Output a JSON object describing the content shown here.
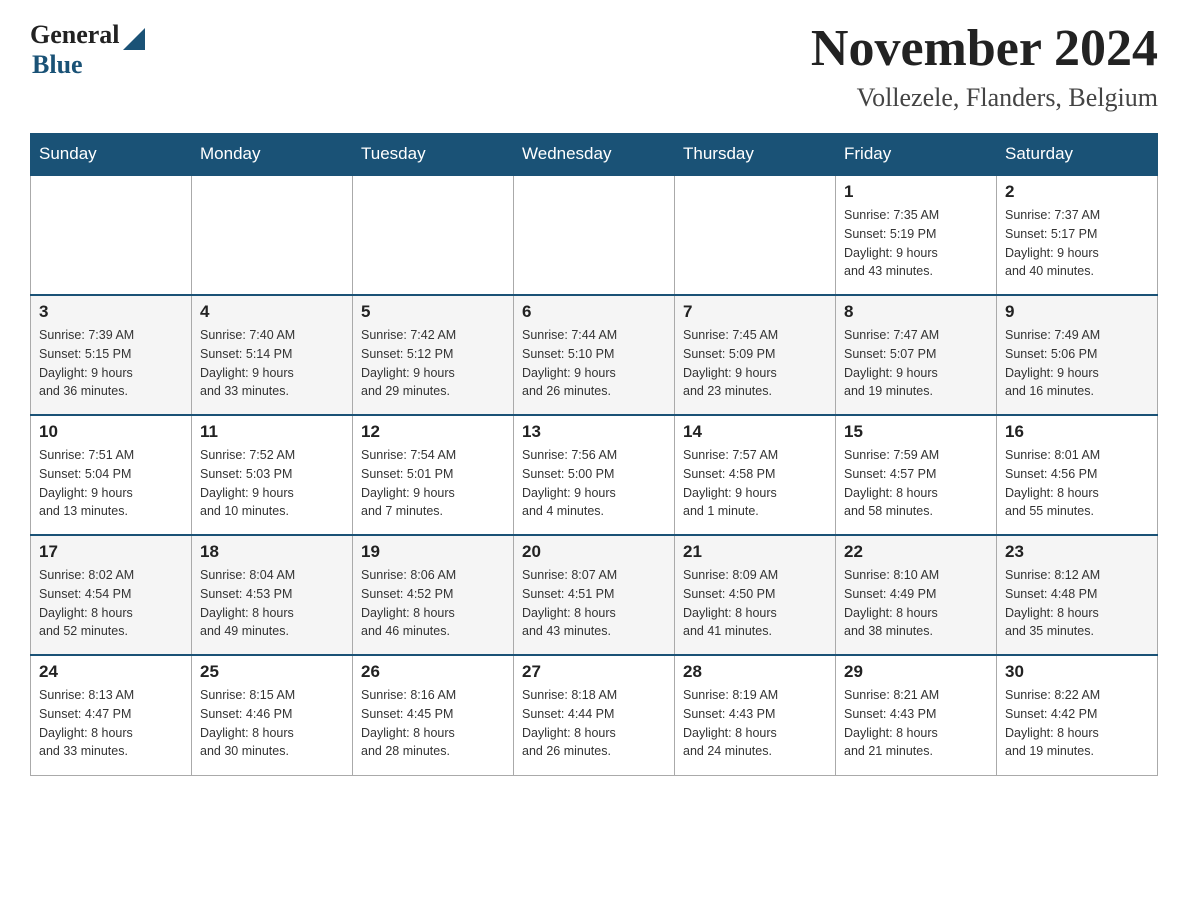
{
  "header": {
    "logo_general": "General",
    "logo_blue": "Blue",
    "title": "November 2024",
    "subtitle": "Vollezele, Flanders, Belgium"
  },
  "weekdays": [
    "Sunday",
    "Monday",
    "Tuesday",
    "Wednesday",
    "Thursday",
    "Friday",
    "Saturday"
  ],
  "weeks": [
    [
      {
        "day": "",
        "info": ""
      },
      {
        "day": "",
        "info": ""
      },
      {
        "day": "",
        "info": ""
      },
      {
        "day": "",
        "info": ""
      },
      {
        "day": "",
        "info": ""
      },
      {
        "day": "1",
        "info": "Sunrise: 7:35 AM\nSunset: 5:19 PM\nDaylight: 9 hours\nand 43 minutes."
      },
      {
        "day": "2",
        "info": "Sunrise: 7:37 AM\nSunset: 5:17 PM\nDaylight: 9 hours\nand 40 minutes."
      }
    ],
    [
      {
        "day": "3",
        "info": "Sunrise: 7:39 AM\nSunset: 5:15 PM\nDaylight: 9 hours\nand 36 minutes."
      },
      {
        "day": "4",
        "info": "Sunrise: 7:40 AM\nSunset: 5:14 PM\nDaylight: 9 hours\nand 33 minutes."
      },
      {
        "day": "5",
        "info": "Sunrise: 7:42 AM\nSunset: 5:12 PM\nDaylight: 9 hours\nand 29 minutes."
      },
      {
        "day": "6",
        "info": "Sunrise: 7:44 AM\nSunset: 5:10 PM\nDaylight: 9 hours\nand 26 minutes."
      },
      {
        "day": "7",
        "info": "Sunrise: 7:45 AM\nSunset: 5:09 PM\nDaylight: 9 hours\nand 23 minutes."
      },
      {
        "day": "8",
        "info": "Sunrise: 7:47 AM\nSunset: 5:07 PM\nDaylight: 9 hours\nand 19 minutes."
      },
      {
        "day": "9",
        "info": "Sunrise: 7:49 AM\nSunset: 5:06 PM\nDaylight: 9 hours\nand 16 minutes."
      }
    ],
    [
      {
        "day": "10",
        "info": "Sunrise: 7:51 AM\nSunset: 5:04 PM\nDaylight: 9 hours\nand 13 minutes."
      },
      {
        "day": "11",
        "info": "Sunrise: 7:52 AM\nSunset: 5:03 PM\nDaylight: 9 hours\nand 10 minutes."
      },
      {
        "day": "12",
        "info": "Sunrise: 7:54 AM\nSunset: 5:01 PM\nDaylight: 9 hours\nand 7 minutes."
      },
      {
        "day": "13",
        "info": "Sunrise: 7:56 AM\nSunset: 5:00 PM\nDaylight: 9 hours\nand 4 minutes."
      },
      {
        "day": "14",
        "info": "Sunrise: 7:57 AM\nSunset: 4:58 PM\nDaylight: 9 hours\nand 1 minute."
      },
      {
        "day": "15",
        "info": "Sunrise: 7:59 AM\nSunset: 4:57 PM\nDaylight: 8 hours\nand 58 minutes."
      },
      {
        "day": "16",
        "info": "Sunrise: 8:01 AM\nSunset: 4:56 PM\nDaylight: 8 hours\nand 55 minutes."
      }
    ],
    [
      {
        "day": "17",
        "info": "Sunrise: 8:02 AM\nSunset: 4:54 PM\nDaylight: 8 hours\nand 52 minutes."
      },
      {
        "day": "18",
        "info": "Sunrise: 8:04 AM\nSunset: 4:53 PM\nDaylight: 8 hours\nand 49 minutes."
      },
      {
        "day": "19",
        "info": "Sunrise: 8:06 AM\nSunset: 4:52 PM\nDaylight: 8 hours\nand 46 minutes."
      },
      {
        "day": "20",
        "info": "Sunrise: 8:07 AM\nSunset: 4:51 PM\nDaylight: 8 hours\nand 43 minutes."
      },
      {
        "day": "21",
        "info": "Sunrise: 8:09 AM\nSunset: 4:50 PM\nDaylight: 8 hours\nand 41 minutes."
      },
      {
        "day": "22",
        "info": "Sunrise: 8:10 AM\nSunset: 4:49 PM\nDaylight: 8 hours\nand 38 minutes."
      },
      {
        "day": "23",
        "info": "Sunrise: 8:12 AM\nSunset: 4:48 PM\nDaylight: 8 hours\nand 35 minutes."
      }
    ],
    [
      {
        "day": "24",
        "info": "Sunrise: 8:13 AM\nSunset: 4:47 PM\nDaylight: 8 hours\nand 33 minutes."
      },
      {
        "day": "25",
        "info": "Sunrise: 8:15 AM\nSunset: 4:46 PM\nDaylight: 8 hours\nand 30 minutes."
      },
      {
        "day": "26",
        "info": "Sunrise: 8:16 AM\nSunset: 4:45 PM\nDaylight: 8 hours\nand 28 minutes."
      },
      {
        "day": "27",
        "info": "Sunrise: 8:18 AM\nSunset: 4:44 PM\nDaylight: 8 hours\nand 26 minutes."
      },
      {
        "day": "28",
        "info": "Sunrise: 8:19 AM\nSunset: 4:43 PM\nDaylight: 8 hours\nand 24 minutes."
      },
      {
        "day": "29",
        "info": "Sunrise: 8:21 AM\nSunset: 4:43 PM\nDaylight: 8 hours\nand 21 minutes."
      },
      {
        "day": "30",
        "info": "Sunrise: 8:22 AM\nSunset: 4:42 PM\nDaylight: 8 hours\nand 19 minutes."
      }
    ]
  ]
}
